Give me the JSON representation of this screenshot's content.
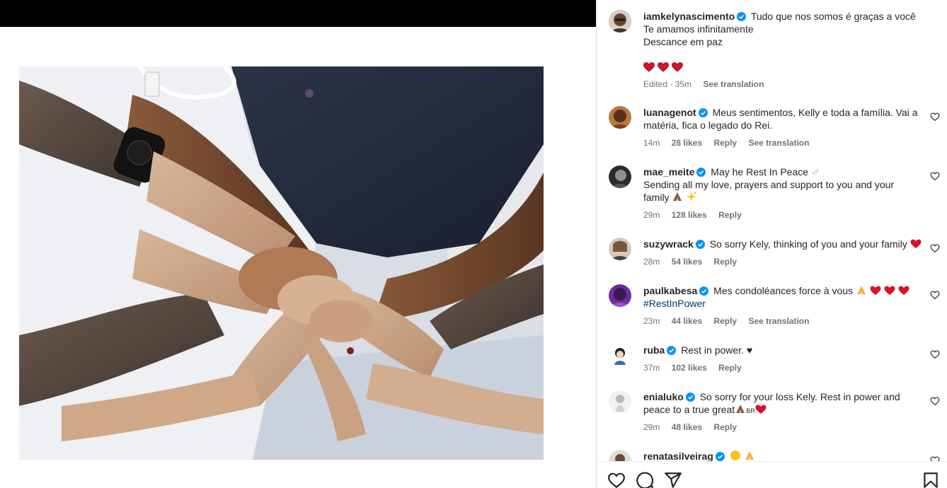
{
  "post": {
    "author": "iamkelynascimento",
    "caption_lines": [
      "Tudo que nos somos é graças a você",
      "Te amamos infinitamente",
      "Descance em paz"
    ],
    "caption_emojis": [
      "heart",
      "heart",
      "heart"
    ],
    "edited_time": "Edited · 35m",
    "see_translation": "See translation"
  },
  "comments": [
    {
      "user": "luanagenot",
      "verified": true,
      "text_1": "Meus sentimentos, Kelly e toda a família. Vai a",
      "text_2": "matéria, fica o legado do Rei.",
      "time": "14m",
      "likes": "28 likes",
      "reply": "Reply",
      "translation": "See translation"
    },
    {
      "user": "mae_meite",
      "verified": true,
      "text_1": "May he Rest In Peace",
      "text_2": "Sending all my love, prayers and support to you and your",
      "text_3": "family",
      "time": "29m",
      "likes": "128 likes",
      "reply": "Reply"
    },
    {
      "user": "suzywrack",
      "verified": true,
      "text_1": "So sorry Kely, thinking of you and your family",
      "time": "28m",
      "likes": "54 likes",
      "reply": "Reply"
    },
    {
      "user": "paulkabesa",
      "verified": true,
      "text_1": "Mes condoléances force à vous",
      "text_2": "#RestInPower",
      "time": "23m",
      "likes": "44 likes",
      "reply": "Reply",
      "translation": "See translation"
    },
    {
      "user": "ruba",
      "verified": true,
      "text_1": "Rest in power. ♥",
      "time": "37m",
      "likes": "102 likes",
      "reply": "Reply"
    },
    {
      "user": "enialuko",
      "verified": true,
      "text_1": "So sorry for your loss Kely. Rest in power and",
      "text_2": "peace to a true great",
      "text_2_suffix": "BR",
      "time": "29m",
      "likes": "48 likes",
      "reply": "Reply"
    },
    {
      "user": "renatasilveirag",
      "verified": true
    }
  ],
  "icons": {
    "like": "heart-outline-icon",
    "comment": "comment-bubble-icon",
    "share": "paper-plane-icon",
    "save": "bookmark-icon"
  },
  "colors": {
    "verified": "#0095f6",
    "heart_red": "#e0245e",
    "meta_gray": "#737373"
  }
}
